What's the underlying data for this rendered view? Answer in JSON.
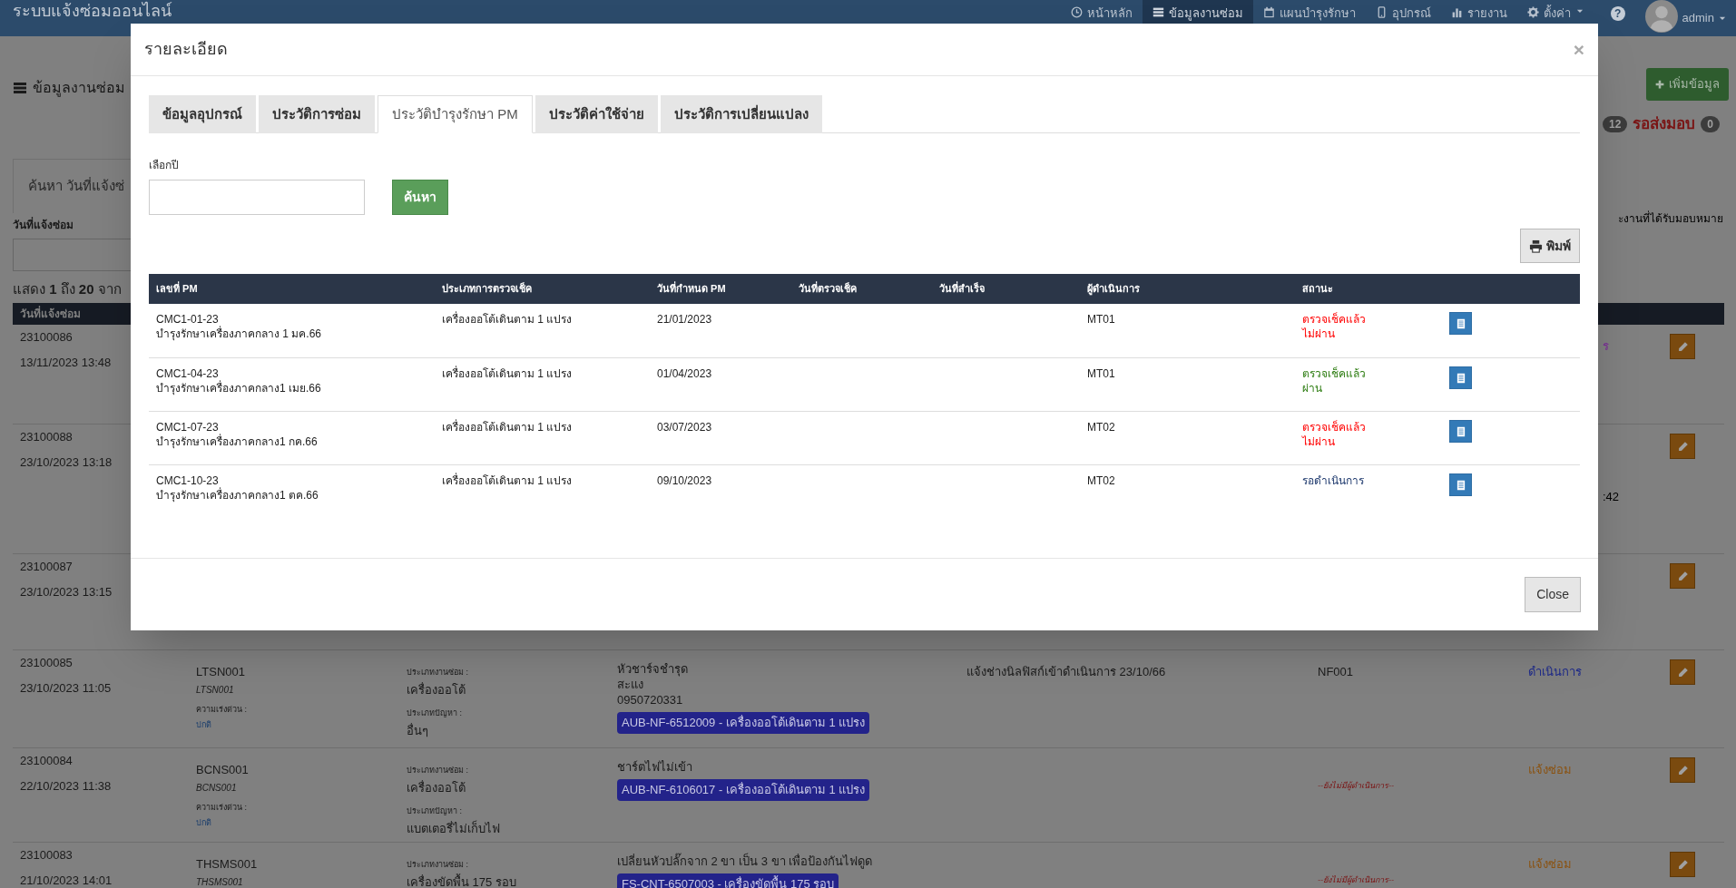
{
  "navbar": {
    "brand": "ระบบแจ้งซ่อมออนไลน์",
    "items": [
      {
        "label": "หน้าหลัก",
        "kind": "clock",
        "selected": false
      },
      {
        "label": "ข้อมูลงานซ่อม",
        "kind": "list",
        "selected": true
      },
      {
        "label": "แผนบำรุงรักษา",
        "kind": "calendar",
        "selected": false
      },
      {
        "label": "อุปกรณ์",
        "kind": "phone",
        "selected": false
      },
      {
        "label": "รายงาน",
        "kind": "chart",
        "selected": false
      },
      {
        "label": "ตั้งค่า",
        "kind": "gear",
        "selected": false,
        "dropdown": true
      }
    ],
    "help": "?",
    "user": "admin"
  },
  "page": {
    "title": "ข้อมูลงานซ่อม",
    "add_button": "เพิ่มข้อมูล",
    "count_1": "12",
    "count_2_label": "รอส่งมอบ",
    "count_2": "0",
    "search_tab": "ค้นหา วันที่แจ้งซ่",
    "right_note": "ะงานที่ได้รับมอบหมาย",
    "date_label": "วันที่แจ้งซ่อม",
    "showing": "แสดง **1** ถึง **20** จาก",
    "table_header": "วันที่แจ้งซ่อม",
    "rows": [
      {
        "id": "23100086",
        "date": "13/11/2023 13:48",
        "fragment": {
          "kind": "status",
          "text": "ร",
          "color": "#7a2e96"
        }
      },
      {
        "id": "23100088",
        "date": "23/10/2023 13:18",
        "fragment": {
          "kind": "note",
          "text": ":42",
          "color": "#000000"
        }
      },
      {
        "id": "23100087",
        "date": "23/10/2023 13:15"
      },
      {
        "id": "23100085",
        "date": "23/10/2023 11:05",
        "code": "LTSN001",
        "code_sub": "LTSN001",
        "urgency_label": "ความเร่งด่วน :",
        "urgency": "ปกติ",
        "type_label": "ประเภทงานซ่อม :",
        "type": "เครื่องออโต้",
        "problem_label": "ประเภทปัญหา :",
        "problem": "อื่นๆ",
        "details": [
          "หัวชาร์จชำรุด",
          "สะแง",
          "0950720331"
        ],
        "asset": "AUB-NF-6512009 - เครื่องออโต้เดินตาม 1 แปรง",
        "note": "แจ้งช่างนิลฟิสก์เข้าดำเนินการ 23/10/66",
        "technician": {
          "kind": "name",
          "text": "NF001"
        },
        "status": {
          "text": "ดำเนินการ",
          "color": "#1e2a8a"
        }
      },
      {
        "id": "23100084",
        "date": "22/10/2023 11:38",
        "code": "BCNS001",
        "code_sub": "BCNS001",
        "urgency_label": "ความเร่งด่วน :",
        "urgency": "ปกติ",
        "type_label": "ประเภทงานซ่อม :",
        "type": "เครื่องออโต้",
        "problem_label": "ประเภทปัญหา :",
        "problem": "แบตเตอรี่ไม่เก็บไฟ",
        "details": [
          "ชาร์ตไฟไม่เข้า"
        ],
        "asset": "AUB-NF-6106017 - เครื่องออโต้เดินตาม 1 แปรง",
        "technician": {
          "kind": "none",
          "text": "--ยังไม่มีผู้ดำเนินการ--"
        },
        "status": {
          "text": "แจ้งซ่อม",
          "color": "#8a5210"
        }
      },
      {
        "id": "23100083",
        "date": "21/10/2023 14:01",
        "code": "THSMS001",
        "code_sub": "THSMS001",
        "type_label": "ประเภทงานซ่อม :",
        "type": "เครื่องขัดพื้น 175 รอบ",
        "details": [
          "เปลี่ยนหัวปลั๊กจาก 2 ขา เป็น 3 ขา เพื่อป้องกันไฟดูด"
        ],
        "asset": "FS-CNT-6507003 - เครื่องขัดพื้น 175 รอบ",
        "technician": {
          "kind": "none",
          "text": "--ยังไม่มีผู้ดำเนินการ--"
        },
        "status": {
          "text": "แจ้งซ่อม",
          "color": "#8a5210"
        }
      }
    ]
  },
  "modal": {
    "title": "รายละเอียด",
    "close_icon": "×",
    "tabs": [
      {
        "label": "ข้อมูลอุปกรณ์",
        "selected": false
      },
      {
        "label": "ประวัติการซ่อม",
        "selected": false
      },
      {
        "label": "ประวัติบำรุงรักษา PM",
        "selected": true
      },
      {
        "label": "ประวัติค่าใช้จ่าย",
        "selected": false
      },
      {
        "label": "ประวัติการเปลี่ยนแปลง",
        "selected": false
      }
    ],
    "year_label": "เลือกปี",
    "search_button": "ค้นหา",
    "print_button": "พิมพ์",
    "columns": [
      "เลขที่ PM",
      "ประเภทการตรวจเช็ค",
      "วันที่กำหนด PM",
      "วันที่ตรวจเช็ค",
      "วันที่สำเร็จ",
      "ผู้ดำเนินการ",
      "สถานะ"
    ],
    "rows": [
      {
        "pm_no": "CMC1-01-23",
        "pm_name": "บำรุงรักษาเครื่องภาคกลาง 1 มค.66",
        "check_type": "เครื่องออโต้เดินตาม 1 แปรง",
        "due_date": "21/01/2023",
        "operator": "MT01",
        "status": [
          "ตรวจเช็คแล้ว",
          "ไม่ผ่าน"
        ],
        "color": "#ff0000"
      },
      {
        "pm_no": "CMC1-04-23",
        "pm_name": "บำรุงรักษาเครื่องภาคกลาง1 เมย.66",
        "check_type": "เครื่องออโต้เดินตาม 1 แปรง",
        "due_date": "01/04/2023",
        "operator": "MT01",
        "status": [
          "ตรวจเช็คแล้ว",
          "ผ่าน"
        ],
        "color": "#2e7d12"
      },
      {
        "pm_no": "CMC1-07-23",
        "pm_name": "บำรุงรักษาเครื่องภาคกลาง1 กค.66",
        "check_type": "เครื่องออโต้เดินตาม 1 แปรง",
        "due_date": "03/07/2023",
        "operator": "MT02",
        "status": [
          "ตรวจเช็คแล้ว",
          "ไม่ผ่าน"
        ],
        "color": "#ff0000"
      },
      {
        "pm_no": "CMC1-10-23",
        "pm_name": "บำรุงรักษาเครื่องภาคกลาง1 ตค.66",
        "check_type": "เครื่องออโต้เดินตาม 1 แปรง",
        "due_date": "09/10/2023",
        "operator": "MT02",
        "status": [
          "รอดำเนินการ"
        ],
        "color": "#1f3a6e"
      }
    ],
    "close_button": "Close"
  }
}
